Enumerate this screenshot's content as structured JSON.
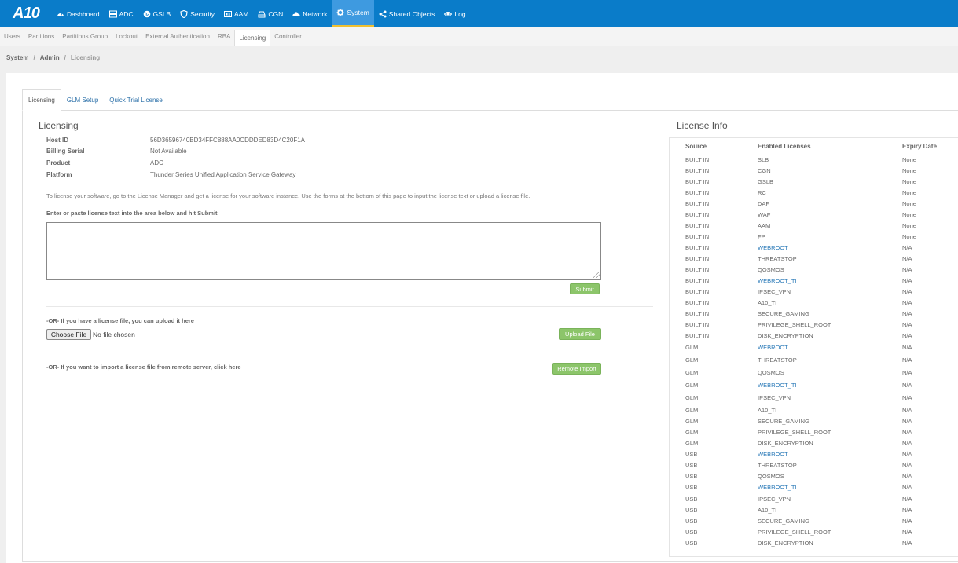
{
  "nav": {
    "logo": "A10",
    "items": [
      {
        "label": "Dashboard",
        "icon": "dashboard-icon"
      },
      {
        "label": "ADC",
        "icon": "server-icon"
      },
      {
        "label": "GSLB",
        "icon": "globe-icon"
      },
      {
        "label": "Security",
        "icon": "shield-icon"
      },
      {
        "label": "AAM",
        "icon": "id-card-icon"
      },
      {
        "label": "CGN",
        "icon": "hdd-icon"
      },
      {
        "label": "Network",
        "icon": "cloud-icon"
      },
      {
        "label": "System",
        "icon": "gear-icon"
      },
      {
        "label": "Shared Objects",
        "icon": "share-icon"
      },
      {
        "label": "Log",
        "icon": "eye-icon"
      }
    ],
    "active": "System"
  },
  "subnav": {
    "items": [
      "Users",
      "Partitions",
      "Partitions Group",
      "Lockout",
      "External Authentication",
      "RBA",
      "Licensing",
      "Controller"
    ],
    "active": "Licensing"
  },
  "breadcrumb": [
    "System",
    "Admin",
    "Licensing"
  ],
  "tabs": [
    "Licensing",
    "GLM Setup",
    "Quick Trial License"
  ],
  "licensing": {
    "title": "Licensing",
    "fields": [
      {
        "key": "Host ID",
        "value": "56D36596740BD34FFC888AA0CDDDED83D4C20F1A"
      },
      {
        "key": "Billing Serial",
        "value": "Not Available"
      },
      {
        "key": "Product",
        "value": "ADC"
      },
      {
        "key": "Platform",
        "value": "Thunder Series Unified Application Service Gateway"
      }
    ],
    "info": "To license your software, go to the License Manager and get a license for your software instance. Use the forms at the bottom of this page to input the license text or upload a license file.",
    "paste_label": "Enter or paste license text into the area below and hit Submit",
    "submit": "Submit",
    "upload_label": "-OR- If you have a license file, you can upload it here",
    "choose_file": "Choose File",
    "no_file": "No file chosen",
    "upload_button": "Upload File",
    "remote_label": "-OR- If you want to import a license file from remote server, click here",
    "remote_button": "Remote Import"
  },
  "license_info": {
    "title": "License Info",
    "headers": [
      "Source",
      "Enabled Licenses",
      "Expiry Date"
    ],
    "rows": [
      {
        "source": "BUILT IN",
        "license": "SLB",
        "expiry": "None",
        "link": false
      },
      {
        "source": "BUILT IN",
        "license": "CGN",
        "expiry": "None",
        "link": false
      },
      {
        "source": "BUILT IN",
        "license": "GSLB",
        "expiry": "None",
        "link": false
      },
      {
        "source": "BUILT IN",
        "license": "RC",
        "expiry": "None",
        "link": false
      },
      {
        "source": "BUILT IN",
        "license": "DAF",
        "expiry": "None",
        "link": false
      },
      {
        "source": "BUILT IN",
        "license": "WAF",
        "expiry": "None",
        "link": false
      },
      {
        "source": "BUILT IN",
        "license": "AAM",
        "expiry": "None",
        "link": false
      },
      {
        "source": "BUILT IN",
        "license": "FP",
        "expiry": "None",
        "link": false
      },
      {
        "source": "BUILT IN",
        "license": "WEBROOT",
        "expiry": "N/A",
        "link": true
      },
      {
        "source": "BUILT IN",
        "license": "THREATSTOP",
        "expiry": "N/A",
        "link": false
      },
      {
        "source": "BUILT IN",
        "license": "QOSMOS",
        "expiry": "N/A",
        "link": false
      },
      {
        "source": "BUILT IN",
        "license": "WEBROOT_TI",
        "expiry": "N/A",
        "link": true
      },
      {
        "source": "BUILT IN",
        "license": "IPSEC_VPN",
        "expiry": "N/A",
        "link": false
      },
      {
        "source": "BUILT IN",
        "license": "A10_TI",
        "expiry": "N/A",
        "link": false
      },
      {
        "source": "BUILT IN",
        "license": "SECURE_GAMING",
        "expiry": "N/A",
        "link": false
      },
      {
        "source": "BUILT IN",
        "license": "PRIVILEGE_SHELL_ROOT",
        "expiry": "N/A",
        "link": false
      },
      {
        "source": "BUILT IN",
        "license": "DISK_ENCRYPTION",
        "expiry": "N/A",
        "link": false
      },
      {
        "source": "GLM",
        "license": "WEBROOT",
        "expiry": "N/A",
        "link": true
      },
      {
        "source": "GLM",
        "license": "THREATSTOP",
        "expiry": "N/A",
        "link": false
      },
      {
        "source": "GLM",
        "license": "QOSMOS",
        "expiry": "N/A",
        "link": false
      },
      {
        "source": "GLM",
        "license": "WEBROOT_TI",
        "expiry": "N/A",
        "link": true
      },
      {
        "source": "GLM",
        "license": "IPSEC_VPN",
        "expiry": "N/A",
        "link": false
      },
      {
        "source": "GLM",
        "license": "A10_TI",
        "expiry": "N/A",
        "link": false
      },
      {
        "source": "GLM",
        "license": "SECURE_GAMING",
        "expiry": "N/A",
        "link": false
      },
      {
        "source": "GLM",
        "license": "PRIVILEGE_SHELL_ROOT",
        "expiry": "N/A",
        "link": false
      },
      {
        "source": "GLM",
        "license": "DISK_ENCRYPTION",
        "expiry": "N/A",
        "link": false
      },
      {
        "source": "USB",
        "license": "WEBROOT",
        "expiry": "N/A",
        "link": true
      },
      {
        "source": "USB",
        "license": "THREATSTOP",
        "expiry": "N/A",
        "link": false
      },
      {
        "source": "USB",
        "license": "QOSMOS",
        "expiry": "N/A",
        "link": false
      },
      {
        "source": "USB",
        "license": "WEBROOT_TI",
        "expiry": "N/A",
        "link": true
      },
      {
        "source": "USB",
        "license": "IPSEC_VPN",
        "expiry": "N/A",
        "link": false
      },
      {
        "source": "USB",
        "license": "A10_TI",
        "expiry": "N/A",
        "link": false
      },
      {
        "source": "USB",
        "license": "SECURE_GAMING",
        "expiry": "N/A",
        "link": false
      },
      {
        "source": "USB",
        "license": "PRIVILEGE_SHELL_ROOT",
        "expiry": "N/A",
        "link": false
      },
      {
        "source": "USB",
        "license": "DISK_ENCRYPTION",
        "expiry": "N/A",
        "link": false
      }
    ]
  },
  "colors": {
    "nav_bg": "#0a7cc9",
    "nav_active": "#3e9ae0",
    "nav_active_underline": "#f0c030",
    "button_green": "#8cc56a",
    "link": "#2a7ab8"
  }
}
